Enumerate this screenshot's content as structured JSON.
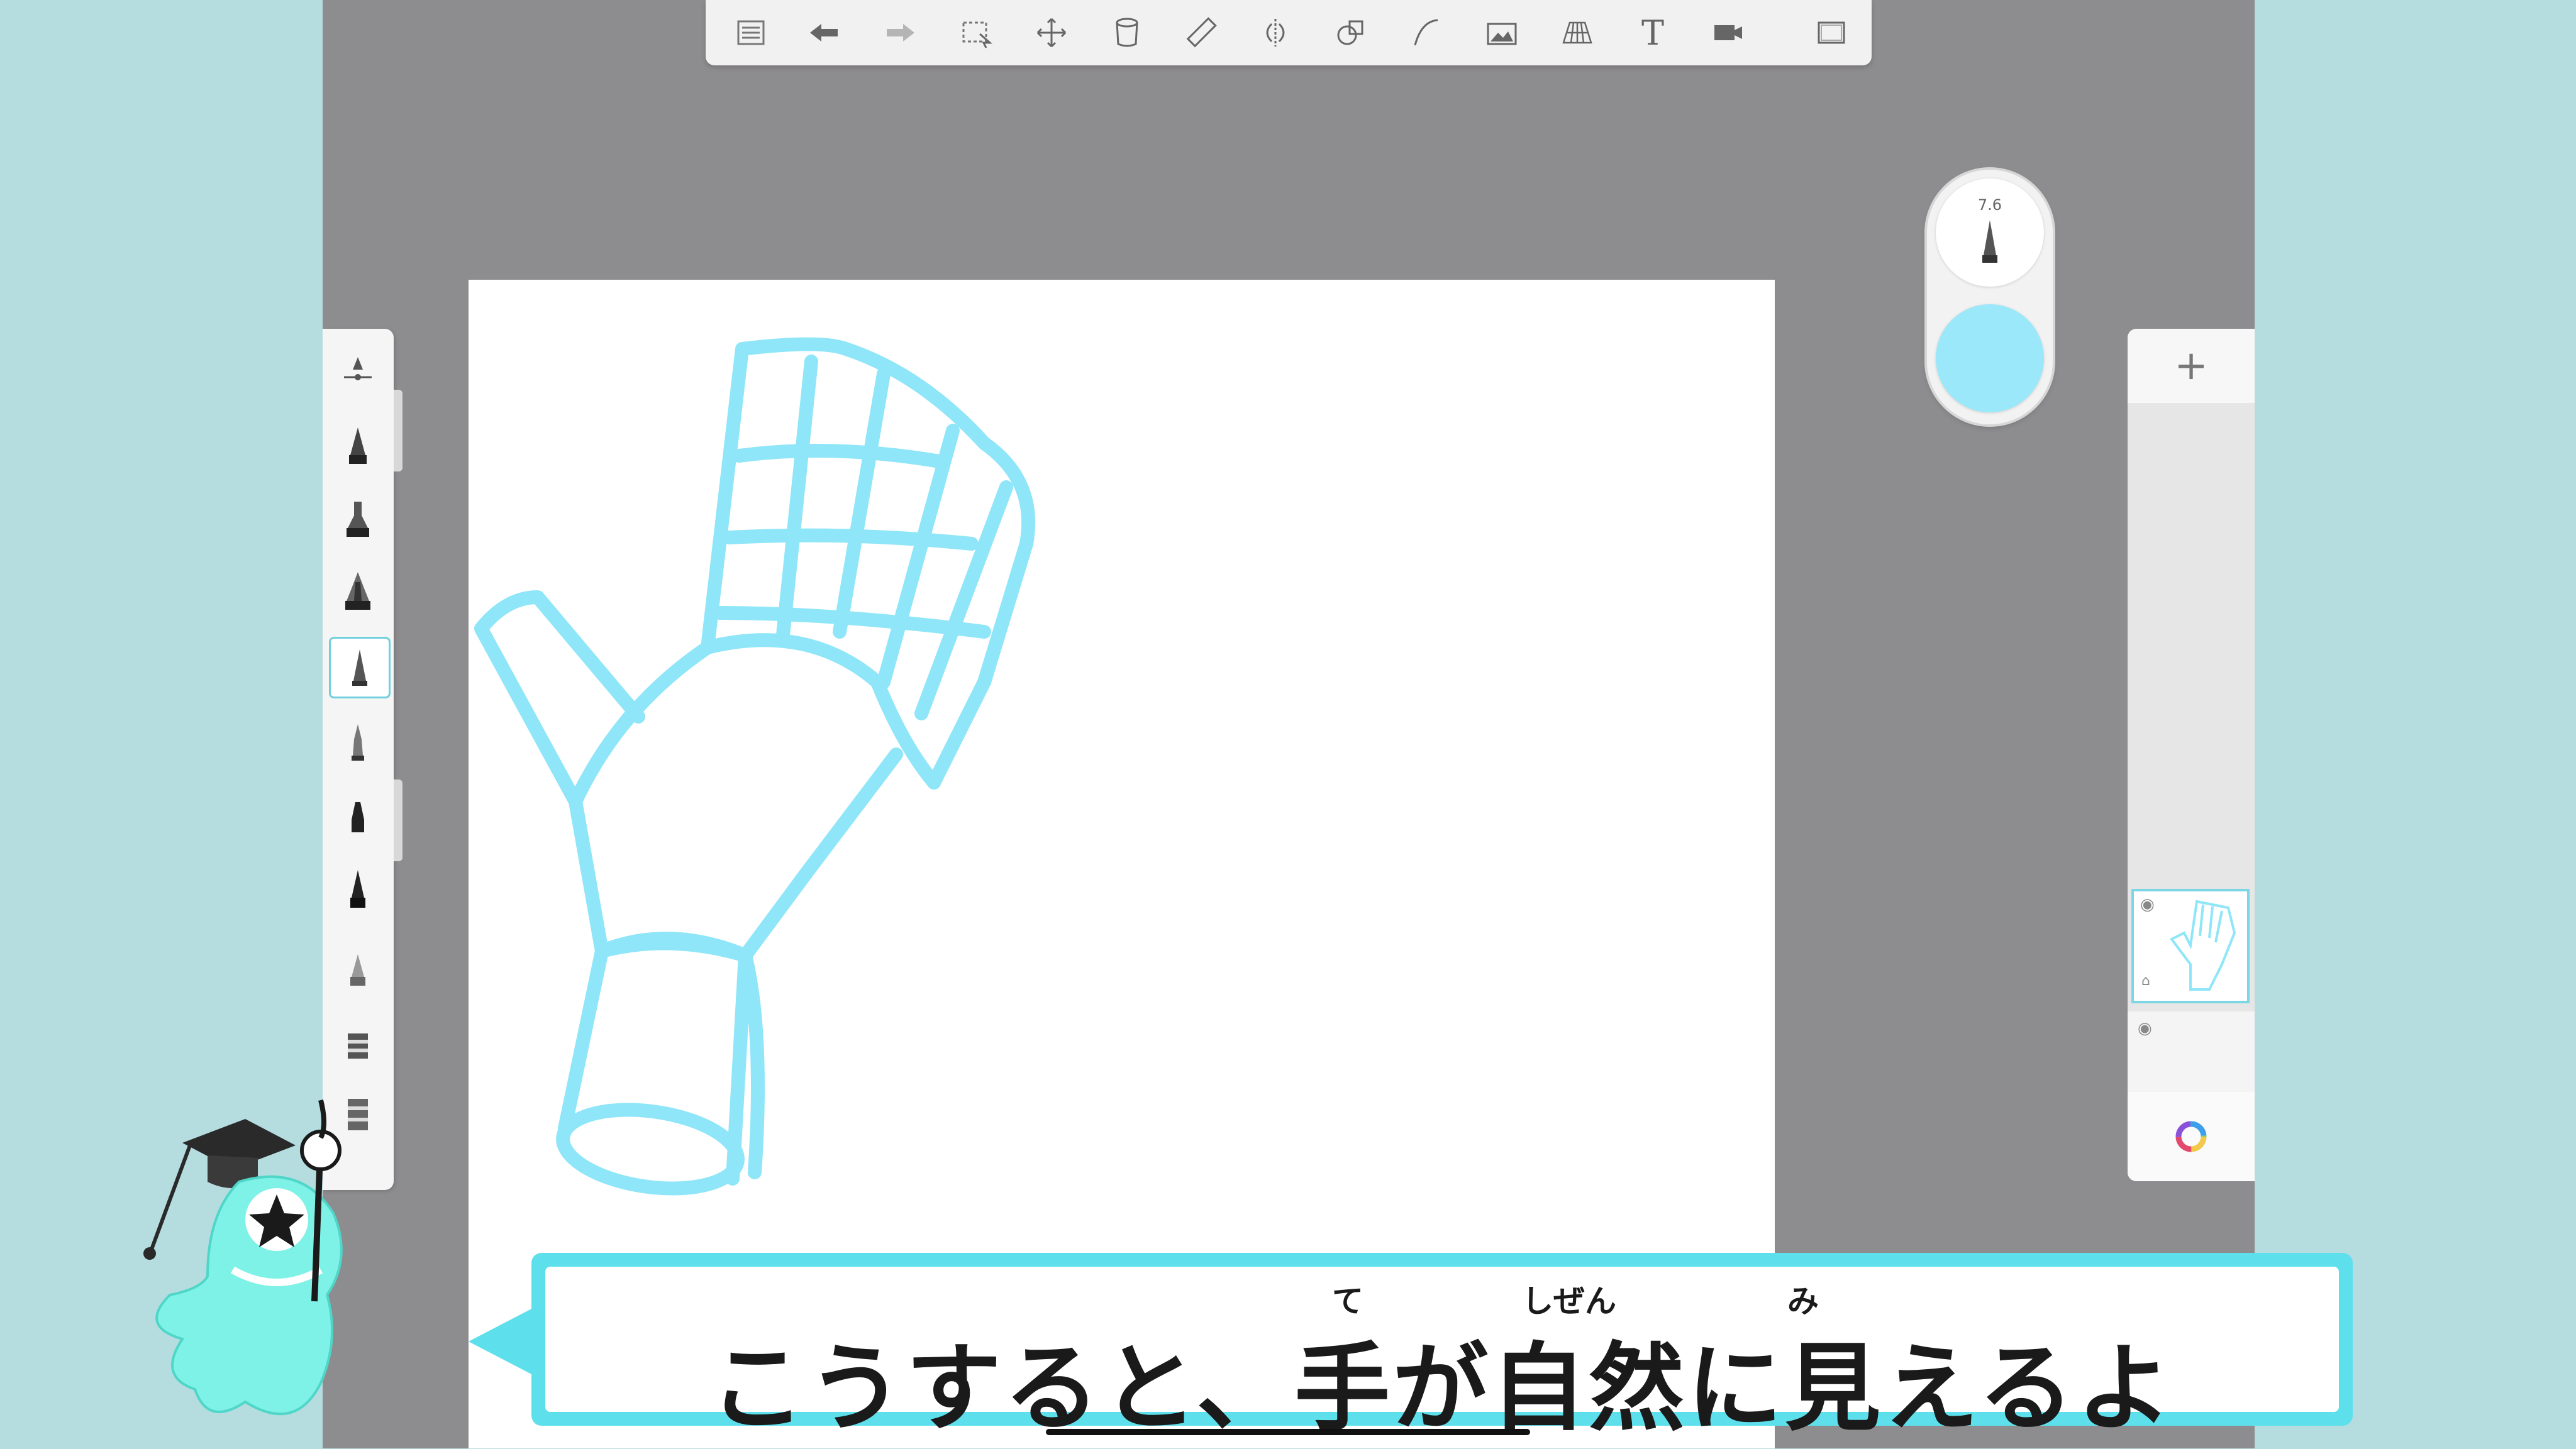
{
  "toolbar": {
    "icons": [
      "list-icon",
      "undo-icon",
      "redo-icon",
      "select-icon",
      "move-icon",
      "fill-icon",
      "ruler-icon",
      "symmetry-icon",
      "shape-icon",
      "curve-icon",
      "image-icon",
      "perspective-icon",
      "text-icon",
      "record-icon",
      "fullscreen-icon"
    ],
    "text_glyph": "T"
  },
  "puck": {
    "brush_size": "7.6",
    "color": "#9ae8fa"
  },
  "brushes": {
    "selected_index": 4,
    "count": 11
  },
  "layers": {
    "add_label": "+"
  },
  "subtitle": {
    "text": "こうすると、手が自然に見えるよ",
    "furigana": [
      "て",
      "しぜん",
      "み"
    ]
  },
  "colors": {
    "stroke": "#8fe6f8",
    "accent": "#5ee0ec",
    "background": "#b5dde0"
  }
}
